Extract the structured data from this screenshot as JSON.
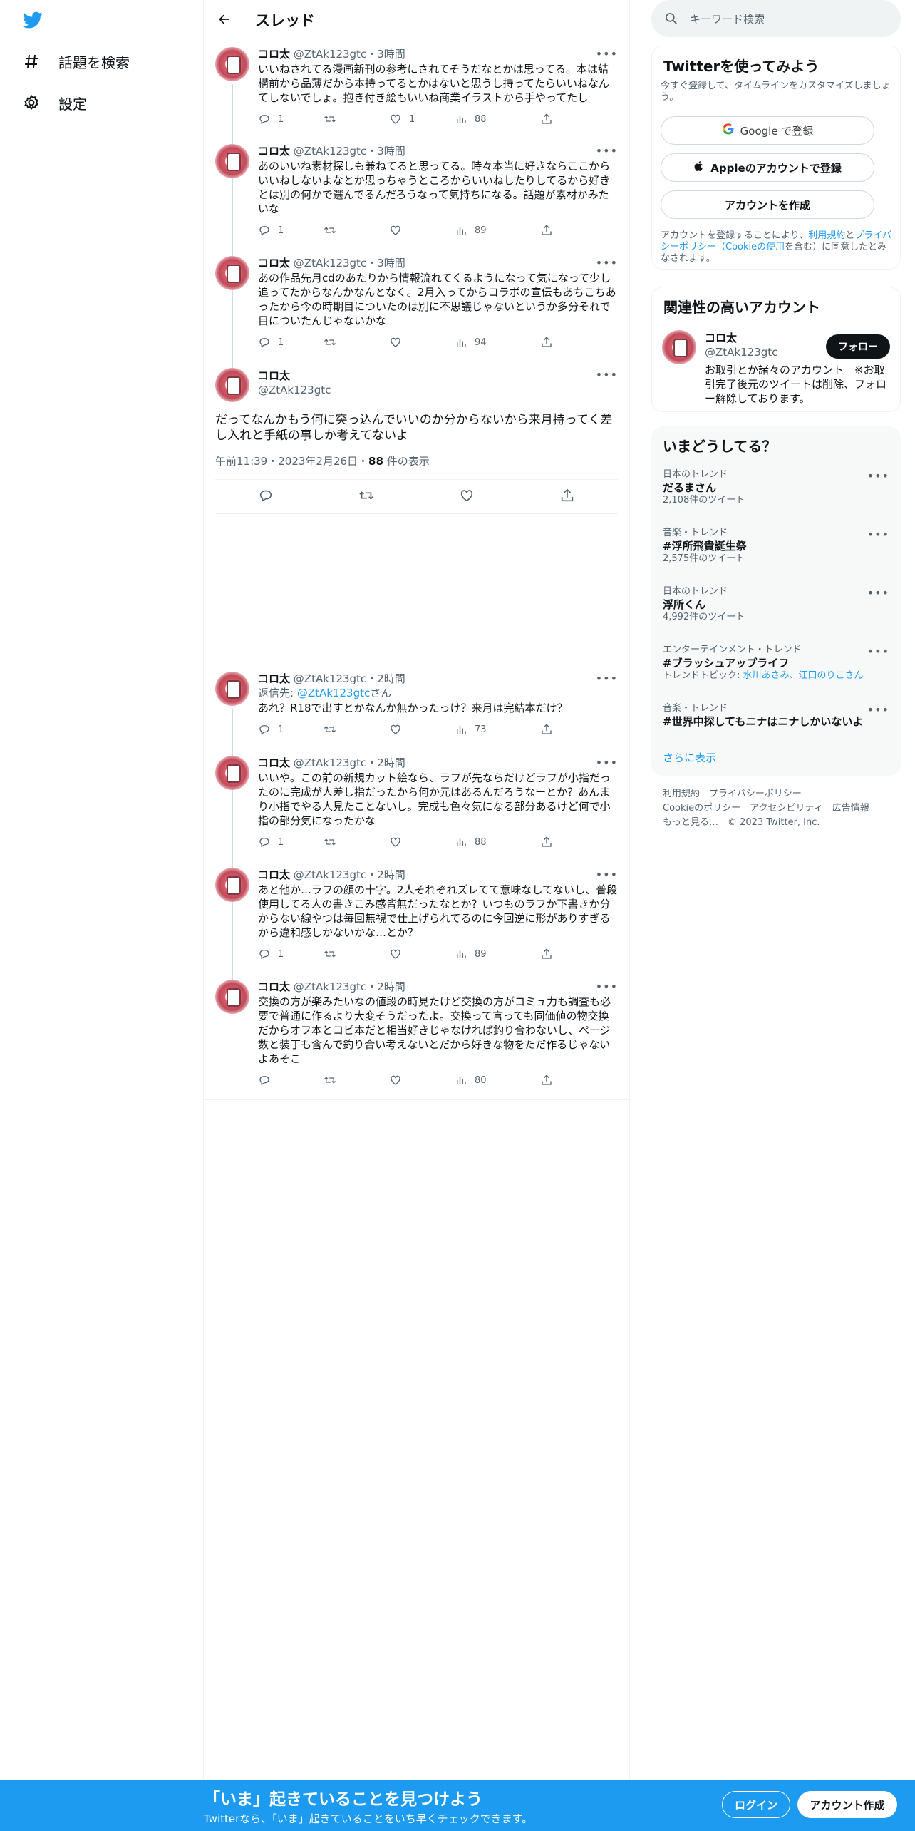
{
  "nav": {
    "logo": "twitter-bird-icon",
    "items": [
      {
        "label": "話題を検索",
        "icon": "hashtag-icon"
      },
      {
        "label": "設定",
        "icon": "gear-icon"
      }
    ]
  },
  "header": {
    "title": "スレッド"
  },
  "thread_before": [
    {
      "name": "コロ太",
      "handle": "@ZtAk123gtc",
      "time": "3時間",
      "text": "いいねされてる漫画新刊の参考にされてそうだなとかは思ってる。本は結構前から品薄だから本持ってるとかはないと思うし持ってたらいいねなんてしないでしょ。抱き付き絵もいいね商業イラストから手やってたし",
      "replies": "1",
      "retweets": "",
      "likes": "1",
      "views": "88"
    },
    {
      "name": "コロ太",
      "handle": "@ZtAk123gtc",
      "time": "3時間",
      "text": "あのいいね素材探しも兼ねてると思ってる。時々本当に好きならここからいいねしないよなとか思っちゃうところからいいねしたりしてるから好きとは別の何かで選んでるんだろうなって気持ちになる。話題が素材かみたいな",
      "replies": "1",
      "retweets": "",
      "likes": "",
      "views": "89"
    },
    {
      "name": "コロ太",
      "handle": "@ZtAk123gtc",
      "time": "3時間",
      "text": "あの作品先月cdのあたりから情報流れてくるようになって気になって少し追ってたからなんかなんとなく。2月入ってからコラボの宣伝もあちこちあったから今の時期目についたのは別に不思議じゃないというか多分それで目についたんじゃないかな",
      "replies": "1",
      "retweets": "",
      "likes": "",
      "views": "94"
    }
  ],
  "focus": {
    "name": "コロ太",
    "handle": "@ZtAk123gtc",
    "text": "だってなんかもう何に突っ込んでいいのか分からないから来月持ってく差し入れと手紙の事しか考えてないよ",
    "meta_time": "午前11:39・2023年2月26日・",
    "views": "88",
    "views_label": " 件の表示"
  },
  "thread_after": [
    {
      "name": "コロ太",
      "handle": "@ZtAk123gtc",
      "time": "2時間",
      "reply_prefix": "返信先: ",
      "reply_to": "@ZtAk123gtc",
      "reply_suffix": "さん",
      "text": "あれ？R18で出すとかなんか無かったっけ？来月は完結本だけ？",
      "replies": "1",
      "retweets": "",
      "likes": "",
      "views": "73"
    },
    {
      "name": "コロ太",
      "handle": "@ZtAk123gtc",
      "time": "2時間",
      "text": "いいや。この前の新規カット絵なら、ラフが先ならだけどラフが小指だったのに完成が人差し指だったから何か元はあるんだろうなーとか？あんまり小指でやる人見たことないし。完成も色々気になる部分あるけど何で小指の部分気になったかな",
      "replies": "1",
      "retweets": "",
      "likes": "",
      "views": "88"
    },
    {
      "name": "コロ太",
      "handle": "@ZtAk123gtc",
      "time": "2時間",
      "text": "あと他か…ラフの顔の十字。2人それぞれズレてて意味なしてないし、普段使用してる人の書きこみ感皆無だったなとか？いつものラフか下書きか分からない線やつは毎回無視で仕上げられてるのに今回逆に形がありすぎるから違和感しかないかな…とか？",
      "replies": "1",
      "retweets": "",
      "likes": "",
      "views": "89"
    },
    {
      "name": "コロ太",
      "handle": "@ZtAk123gtc",
      "time": "2時間",
      "text": "交換の方が楽みたいなの値段の時見たけど交換の方がコミュ力も調査も必要で普通に作るより大変そうだったよ。交換って言っても同価値の物交換だからオフ本とコピ本だと相当好きじゃなければ釣り合わないし、ページ数と装丁も含んで釣り合い考えないとだから好きな物をただ作るじゃないよあそこ",
      "replies": "",
      "retweets": "",
      "likes": "",
      "views": "80"
    }
  ],
  "search": {
    "placeholder": "キーワード検索"
  },
  "signup": {
    "title": "Twitterを使ってみよう",
    "subtitle": "今すぐ登録して、タイムラインをカスタマイズしましょう。",
    "google_label": "Google で登録",
    "apple_label": "Appleのアカウントで登録",
    "create_label": "アカウントを作成",
    "tos_pre": "アカウントを登録することにより、",
    "tos_terms": "利用規約",
    "tos_and": "と",
    "tos_privacy": "プライバシーポリシー（Cookieの使用",
    "tos_post": "を含む）に同意したとみなされます。"
  },
  "related": {
    "title": "関連性の高いアカウント",
    "name": "コロ太",
    "handle": "@ZtAk123gtc",
    "follow_label": "フォロー",
    "bio": "お取引とか諸々のアカウント　※お取引完了後元のツイートは削除、フォロー解除しております。"
  },
  "trends": {
    "title": "いまどうしてる？",
    "items": [
      {
        "context": "日本のトレンド",
        "name": "だるまさん",
        "count": "2,108件のツイート"
      },
      {
        "context": "音楽・トレンド",
        "name": "#浮所飛貴誕生祭",
        "count": "2,575件のツイート"
      },
      {
        "context": "日本のトレンド",
        "name": "浮所くん",
        "count": "4,992件のツイート"
      },
      {
        "context": "エンターテインメント・トレンド",
        "name": "#ブラッシュアップライフ",
        "count_prefix": "トレンドトピック: ",
        "count_link": "水川あさみ、江口のりこさん"
      },
      {
        "context": "音楽・トレンド",
        "name": "#世界中探してもニナはニナしかいないよ",
        "count": ""
      }
    ],
    "show_more": "さらに表示"
  },
  "footer": {
    "line1": "利用規約　プライバシーポリシー",
    "line2": "Cookieのポリシー　アクセシビリティ　広告情報",
    "line3": "もっと見る…　© 2023 Twitter, Inc."
  },
  "banner": {
    "title": "「いま」起きていることを見つけよう",
    "subtitle": "Twitterなら、「いま」起きていることをいち早くチェックできます。",
    "login_label": "ログイン",
    "create_label": "アカウント作成"
  },
  "colors": {
    "accent": "#1d9bf0",
    "text": "#0f1419",
    "muted": "#536471"
  }
}
